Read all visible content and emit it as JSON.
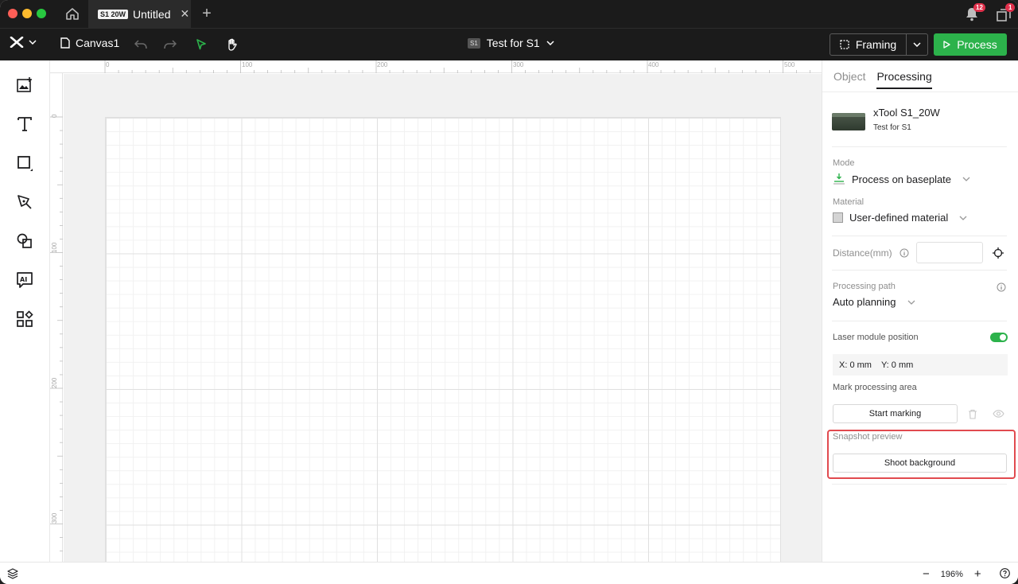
{
  "titlebar": {
    "doc_badge": "S1 20W",
    "doc_title": "Untitled",
    "close_glyph": "✕",
    "new_tab_glyph": "+",
    "notifications_count": "12",
    "windows_count": "1"
  },
  "toolbar": {
    "canvas_name": "Canvas1",
    "device_badge": "S1",
    "device_name": "Test for S1",
    "framing_label": "Framing",
    "process_label": "Process"
  },
  "left_tools": [
    {
      "name": "image-icon"
    },
    {
      "name": "text-icon"
    },
    {
      "name": "shape-icon"
    },
    {
      "name": "pen-icon"
    },
    {
      "name": "combine-icon"
    },
    {
      "name": "ai-icon"
    },
    {
      "name": "apps-icon"
    }
  ],
  "rulers": {
    "top": [
      "0",
      "100",
      "200",
      "300",
      "400",
      "500"
    ],
    "left": [
      "0",
      "100",
      "200",
      "300"
    ]
  },
  "panel": {
    "tabs": [
      "Object",
      "Processing"
    ],
    "device": {
      "name": "xTool S1_20W",
      "subtitle": "Test for S1"
    },
    "mode": {
      "label": "Mode",
      "value": "Process on baseplate"
    },
    "material": {
      "label": "Material",
      "value": "User-defined material"
    },
    "distance": {
      "label": "Distance(mm)",
      "value": ""
    },
    "processing_path": {
      "label": "Processing path",
      "value": "Auto planning"
    },
    "laser_position": {
      "label": "Laser module position",
      "enabled": true,
      "x": "X: 0 mm",
      "y": "Y: 0 mm"
    },
    "mark_area": {
      "label": "Mark processing area",
      "button": "Start marking"
    },
    "snapshot": {
      "label": "Snapshot preview",
      "button": "Shoot background"
    }
  },
  "bottombar": {
    "zoom_value": "196%",
    "zoom_out": "−",
    "zoom_in": "+"
  },
  "colors": {
    "accent_green": "#2cb24b",
    "highlight_red": "#e14a4f",
    "badge_red": "#e0304b"
  }
}
